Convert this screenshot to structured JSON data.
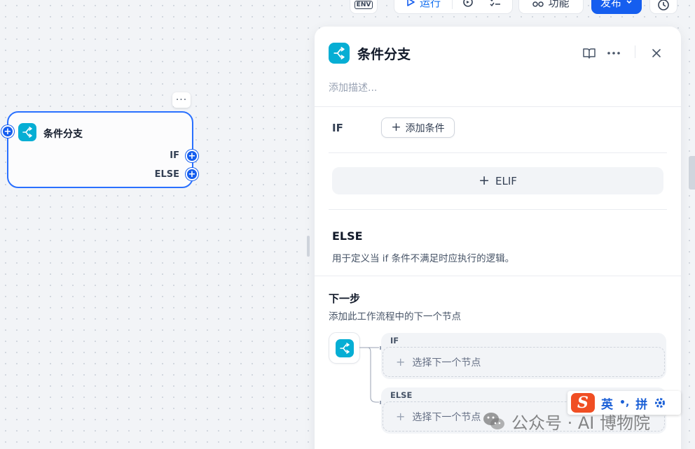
{
  "toolbar": {
    "env_label": "ENV",
    "run_label": "运行",
    "functions_label": "功能",
    "publish_label": "发布"
  },
  "canvas_node": {
    "title": "条件分支",
    "ports": [
      "IF",
      "ELSE"
    ],
    "menu": "···"
  },
  "panel": {
    "title": "条件分支",
    "description_placeholder": "添加描述...",
    "if_label": "IF",
    "add_condition_label": "添加条件",
    "elif_label": "ELIF",
    "else_title": "ELSE",
    "else_description": "用于定义当 if 条件不满足时应执行的逻辑。",
    "next_step": {
      "title": "下一步",
      "description": "添加此工作流程中的下一个节点",
      "branches": [
        {
          "label": "IF",
          "slot_text": "选择下一个节点"
        },
        {
          "label": "ELSE",
          "slot_text": "选择下一个节点"
        }
      ]
    }
  },
  "ime": {
    "logo": "S",
    "mode": "英",
    "punct": "•,",
    "layout": "拼"
  },
  "watermark": {
    "text": "公众号 · AI 博物院"
  },
  "colors": {
    "accent": "#155eef",
    "node_icon": "#06aed4",
    "ime_logo": "#f04e23"
  },
  "icons": {
    "node": "branch-icon",
    "doc": "book-open-icon",
    "more": "more-horizontal-icon",
    "close": "close-icon",
    "history": "clock-icon"
  }
}
